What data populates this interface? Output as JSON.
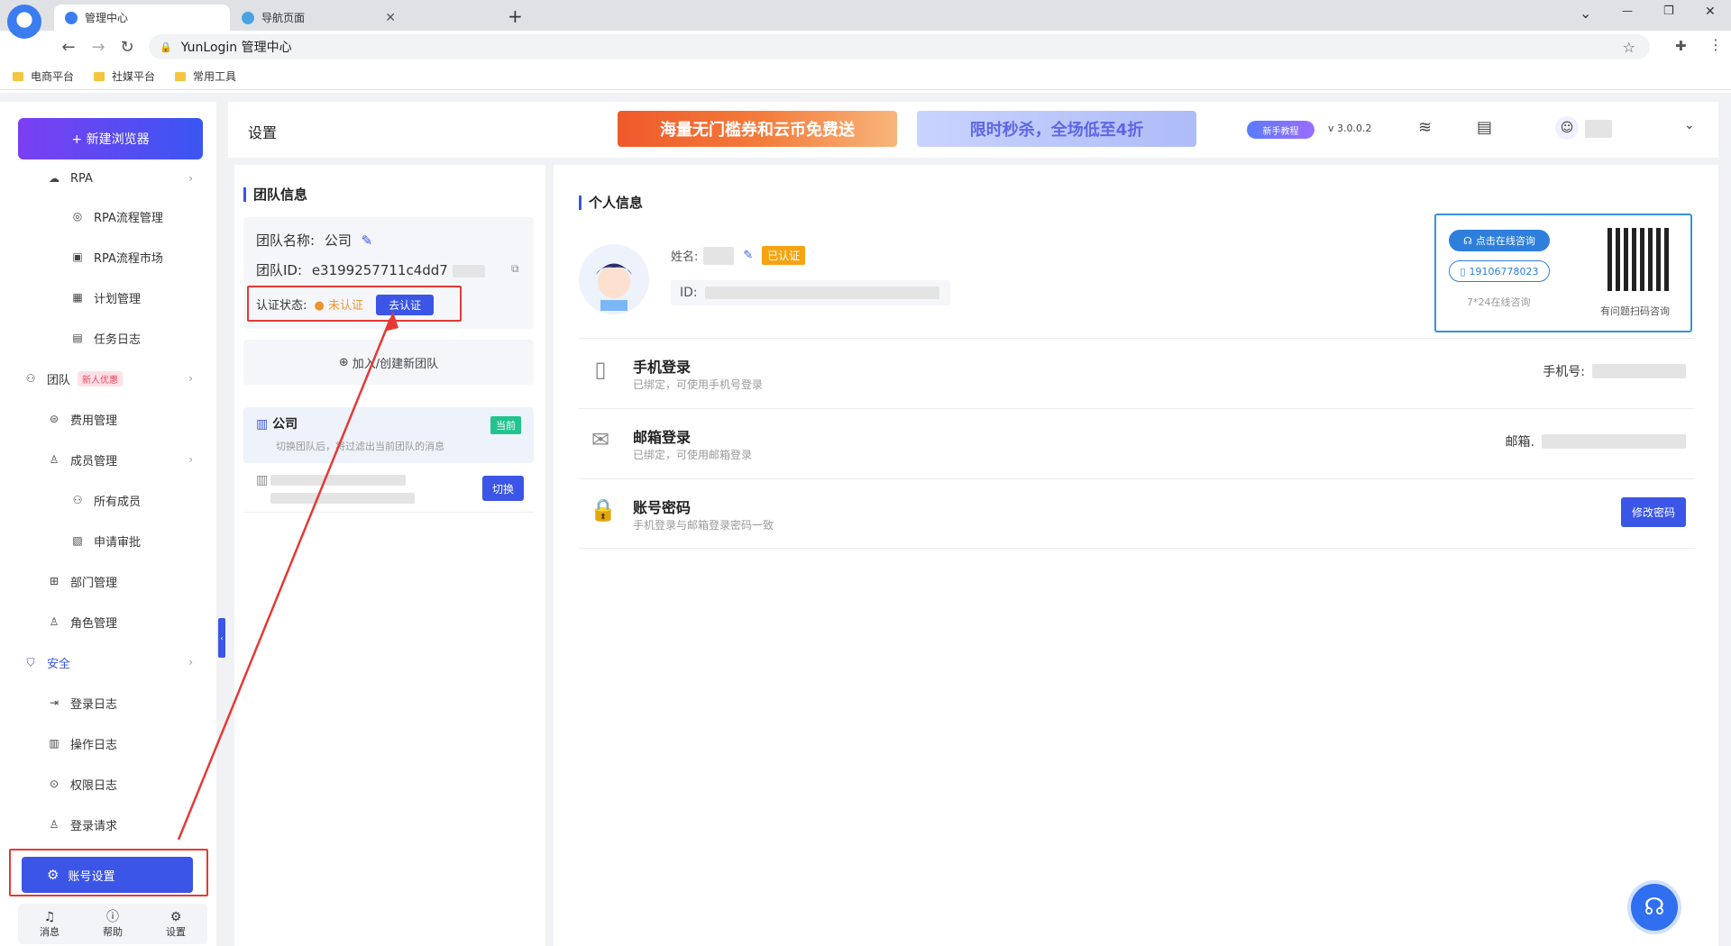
{
  "browser": {
    "tabs": [
      {
        "label": "管理中心",
        "active": true
      },
      {
        "label": "导航页面",
        "active": false
      }
    ],
    "new_tab": "+",
    "address": "YunLogin 管理中心",
    "bookmarks": [
      "电商平台",
      "社媒平台",
      "常用工具"
    ],
    "window_controls": [
      "⌄",
      "—",
      "❐",
      "✕"
    ]
  },
  "sidebar": {
    "new_browser": "+ 新建浏览器",
    "items": [
      {
        "label": "RPA",
        "icon": "rpa-icon",
        "level": 1,
        "arrow": "›"
      },
      {
        "label": "RPA流程管理",
        "icon": "flow-icon",
        "level": 2
      },
      {
        "label": "RPA流程市场",
        "icon": "market-icon",
        "level": 2
      },
      {
        "label": "计划管理",
        "icon": "calendar-icon",
        "level": 2
      },
      {
        "label": "任务日志",
        "icon": "log-icon",
        "level": 2
      },
      {
        "label": "团队",
        "icon": "team-icon",
        "level": 0,
        "badge": "新人优惠",
        "arrow": "›"
      },
      {
        "label": "费用管理",
        "icon": "fee-icon",
        "level": 1
      },
      {
        "label": "成员管理",
        "icon": "member-icon",
        "level": 1,
        "arrow": "›"
      },
      {
        "label": "所有成员",
        "icon": "users-icon",
        "level": 2
      },
      {
        "label": "申请审批",
        "icon": "approve-icon",
        "level": 2
      },
      {
        "label": "部门管理",
        "icon": "dept-icon",
        "level": 1
      },
      {
        "label": "角色管理",
        "icon": "role-icon",
        "level": 1
      },
      {
        "label": "安全",
        "icon": "shield-icon",
        "level": 0,
        "arrow": "›"
      },
      {
        "label": "登录日志",
        "icon": "login-log-icon",
        "level": 1
      },
      {
        "label": "操作日志",
        "icon": "op-log-icon",
        "level": 1
      },
      {
        "label": "权限日志",
        "icon": "perm-log-icon",
        "level": 1
      },
      {
        "label": "登录请求",
        "icon": "login-req-icon",
        "level": 1
      }
    ],
    "account_settings": "账号设置",
    "bottom": [
      {
        "label": "消息",
        "icon": "bell-icon"
      },
      {
        "label": "帮助",
        "icon": "help-icon"
      },
      {
        "label": "设置",
        "icon": "gear-icon"
      }
    ]
  },
  "header": {
    "title": "设置",
    "banner1": "海量无门槛券和云币免费送",
    "banner2": "限时秒杀，全场低至4折",
    "guide": "新手教程",
    "version": "v 3.0.0.2"
  },
  "team": {
    "title": "团队信息",
    "name_label": "团队名称:",
    "name_value": "公司",
    "id_label": "团队ID:",
    "id_value": "e3199257711c4dd7",
    "cert_label": "认证状态:",
    "cert_status": "未认证",
    "cert_button": "去认证",
    "join_create": "加入/创建新团队",
    "current_team_name": "公司",
    "current_badge": "当前",
    "switch_hint": "切换团队后，将过滤出当前团队的消息",
    "switch_button": "切换"
  },
  "personal": {
    "title": "个人信息",
    "name_label": "姓名:",
    "verified_badge": "已认证",
    "id_label": "ID:",
    "consult": {
      "chat": "点击在线咨询",
      "phone": "19106778023",
      "hours": "7*24在线咨询",
      "qr_caption": "有问题扫码咨询"
    },
    "rows": [
      {
        "title": "手机登录",
        "sub": "已绑定，可使用手机号登录",
        "right": "手机号:"
      },
      {
        "title": "邮箱登录",
        "sub": "已绑定，可使用邮箱登录",
        "right": "邮箱."
      },
      {
        "title": "账号密码",
        "sub": "手机登录与邮箱登录密码一致",
        "right": ""
      }
    ],
    "change_password": "修改密码"
  },
  "colors": {
    "accent": "#3b55e6",
    "warning": "#f0932b",
    "success": "#22c38e",
    "annotation": "#e53935"
  }
}
